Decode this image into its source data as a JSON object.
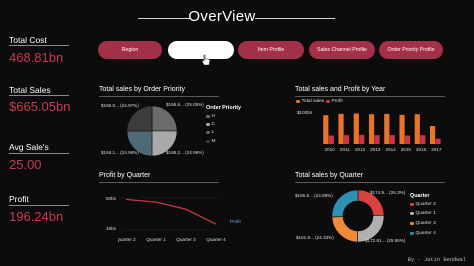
{
  "header": {
    "title": "OverView"
  },
  "kpis": [
    {
      "label": "Total Cost",
      "value": "468.81bn"
    },
    {
      "label": "Total Sales",
      "value": "$665.05bn"
    },
    {
      "label": "Avg Sale's",
      "value": "25.00"
    },
    {
      "label": "Profit",
      "value": "196.24bn"
    }
  ],
  "nav": [
    {
      "label": "Region",
      "active": false
    },
    {
      "label": "",
      "active": true
    },
    {
      "label": "Item Profile",
      "active": false
    },
    {
      "label": "Sales Channel Profile",
      "active": false
    },
    {
      "label": "Order Priority Profile",
      "active": false
    }
  ],
  "panels": {
    "priority": {
      "title": "Total sales by Order Priority",
      "labels": [
        "$166.0... (24.97%)",
        "$166.6... (25.05%)",
        "$166.1... (24.98%)",
        "$166.2... (24.99%)"
      ],
      "legend_title": "Order Priority",
      "legend": [
        "H",
        "C",
        "L",
        "M"
      ]
    },
    "year": {
      "title": "Total sales and Profit by Year",
      "legend": [
        "Total sales",
        "Profit"
      ],
      "ytick": "$100bn"
    },
    "quarter_profit": {
      "title": "Profit by Quarter",
      "yticks": [
        "50bn",
        "45bn"
      ],
      "series_label": "Profit"
    },
    "quarter_sales": {
      "title": "Total sales by Quarter",
      "labels": [
        "$165.5... (24.89%)",
        "$174.9... (26.3%)",
        "$161.8... (24.33%)",
        "$172.61... (25.95%)"
      ],
      "legend_title": "Quarter",
      "legend": [
        "Quarter 2",
        "Quarter 1",
        "Quarter 3",
        "Quarter 4"
      ]
    }
  },
  "colors": {
    "accent": "#a23047",
    "kpi_value": "#c83a52",
    "sales": "#e8742a",
    "profit": "#c93747",
    "pie_slices": [
      "#6b6b6b",
      "#a9a9a9",
      "#4f6a76",
      "#3c3c3c"
    ],
    "donut_slices": [
      "#d9433f",
      "#b0b0b0",
      "#ee8a3a",
      "#2f8fb3"
    ]
  },
  "footer": {
    "credit": "By - Jatin Bendwal"
  },
  "chart_data": [
    {
      "type": "pie",
      "title": "Total sales by Order Priority",
      "categories": [
        "H",
        "C",
        "L",
        "M"
      ],
      "values": [
        166.0,
        166.6,
        166.1,
        166.2
      ],
      "percent": [
        24.97,
        25.05,
        24.98,
        24.99
      ],
      "legend": "right"
    },
    {
      "type": "bar",
      "title": "Total sales and Profit by Year",
      "categories": [
        "2010",
        "2011",
        "2012",
        "2013",
        "2014",
        "2015",
        "2016",
        "2017"
      ],
      "series": [
        {
          "name": "Total sales",
          "values": [
            88,
            92,
            93,
            91,
            92,
            89,
            91,
            55
          ]
        },
        {
          "name": "Profit",
          "values": [
            26,
            27,
            28,
            27,
            27,
            26,
            27,
            16
          ]
        }
      ],
      "ylim": [
        0,
        110
      ],
      "legend": "top-left"
    },
    {
      "type": "line",
      "title": "Profit by Quarter",
      "categories": [
        "Quarter 2",
        "Quarter 1",
        "Quarter 3",
        "Quarter 4"
      ],
      "series": [
        {
          "name": "Profit",
          "values": [
            50.8,
            50.2,
            48.6,
            45.3
          ]
        }
      ],
      "ylim": [
        44,
        52
      ]
    },
    {
      "type": "pie",
      "title": "Total sales by Quarter",
      "categories": [
        "Quarter 2",
        "Quarter 1",
        "Quarter 3",
        "Quarter 4"
      ],
      "values": [
        165.5,
        174.9,
        161.8,
        172.61
      ],
      "percent": [
        24.89,
        26.3,
        24.33,
        25.95
      ],
      "legend": "right"
    }
  ]
}
